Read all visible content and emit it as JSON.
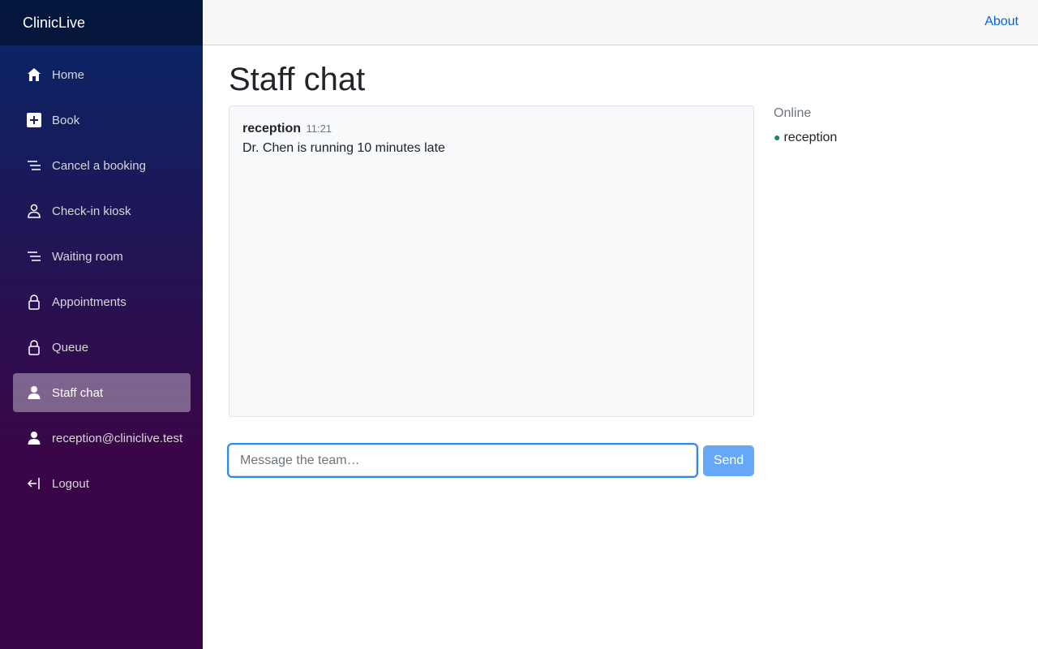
{
  "app": {
    "brand": "ClinicLive"
  },
  "sidebar": {
    "items": [
      {
        "label": "Home",
        "icon": "home-icon"
      },
      {
        "label": "Book",
        "icon": "plus-square-icon"
      },
      {
        "label": "Cancel a booking",
        "icon": "list-icon"
      },
      {
        "label": "Check-in kiosk",
        "icon": "person-outline-icon"
      },
      {
        "label": "Waiting room",
        "icon": "list-icon"
      },
      {
        "label": "Appointments",
        "icon": "lock-icon"
      },
      {
        "label": "Queue",
        "icon": "lock-icon"
      },
      {
        "label": "Staff chat",
        "icon": "person-icon",
        "active": true
      },
      {
        "label": "reception@cliniclive.test",
        "icon": "person-icon"
      },
      {
        "label": "Logout",
        "icon": "logout-icon"
      }
    ]
  },
  "topbar": {
    "about": "About"
  },
  "page": {
    "title": "Staff chat"
  },
  "chat": {
    "messages": [
      {
        "user": "reception",
        "time": "11:21",
        "text": "Dr. Chen is running 10 minutes late"
      }
    ]
  },
  "online": {
    "title": "Online",
    "users": [
      {
        "name": "reception",
        "dot": "●",
        "status_color": "#198754"
      }
    ]
  },
  "composer": {
    "placeholder": "Message the team…",
    "value": "",
    "send_label": "Send"
  },
  "colors": {
    "accent": "#0366d6",
    "send_button": "#66a8f8",
    "active_nav": "rgba(255,255,255,0.37)"
  }
}
